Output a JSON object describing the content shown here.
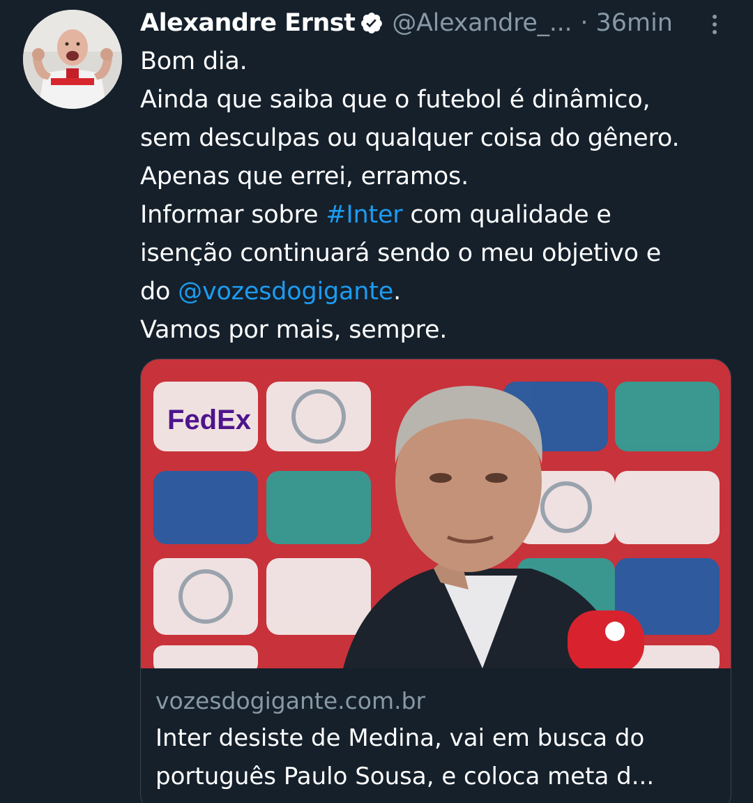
{
  "tweet": {
    "author": {
      "display_name": "Alexandre Ernst",
      "handle": "@Alexandre_...",
      "verified": true
    },
    "separator": "·",
    "timestamp": "36min",
    "text_lines": [
      "Bom dia.",
      "Ainda que saiba que o futebol é dinâmico,",
      "sem desculpas ou qualquer coisa do gênero.",
      "Apenas que errei, erramos."
    ],
    "line5": {
      "before": "Informar sobre ",
      "hashtag": "#Inter",
      "after": " com qualidade e"
    },
    "line6": "isenção continuará sendo o meu objetivo e",
    "line7": {
      "before": "do ",
      "mention": "@vozesdogigante",
      "after": "."
    },
    "line8": "Vamos por mais, sempre.",
    "card": {
      "domain": "vozesdogigante.com.br",
      "title_lines": [
        "Inter desiste de Medina, vai em busca do",
        "português Paulo Sousa, e coloca meta d..."
      ],
      "image_logo_text": "FedEx"
    }
  },
  "colors": {
    "background": "#15202b",
    "primary_text": "#ffffff",
    "secondary_text": "#8899a6",
    "link": "#1d9bf0",
    "border": "#38444d"
  },
  "icons": {
    "verified": "verified-badge-icon",
    "more": "more-vertical-icon"
  }
}
